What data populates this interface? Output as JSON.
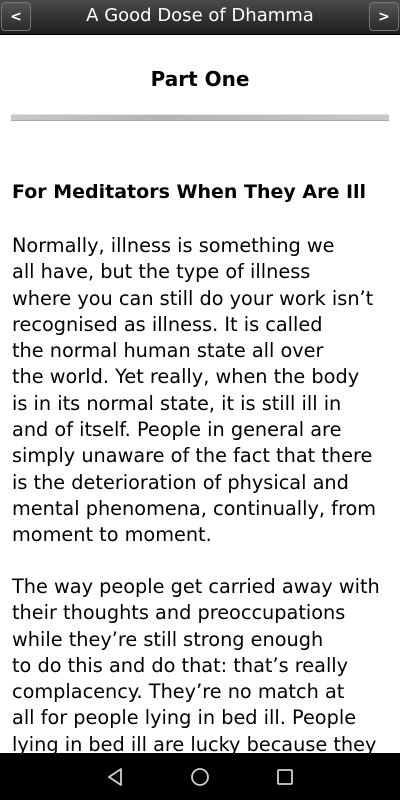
{
  "toolbar": {
    "title": "A Good Dose of Dhamma",
    "prev_label": "<",
    "next_label": ">"
  },
  "content": {
    "part_title": "Part One",
    "section_heading": "For Meditators When They Are Ill",
    "paragraph1_lines": [
      "Normally, illness is something we",
      "all have, but the type of illness",
      "where you can still do your work isn’t",
      "recognised as illness. It is called",
      "the normal human state all over",
      "the world. Yet really, when the body",
      "is in its normal state, it is still ill in",
      "and of itself. People in general are",
      "simply unaware of the fact that there",
      "is the deterioration of physical and",
      "mental phenomena, continually, from",
      "moment to moment."
    ],
    "paragraph2_lines": [
      "The way people get carried away with",
      "their thoughts and preoccupations",
      "while they’re still strong enough",
      "to do this and do that: that’s really",
      "complacency. They’re no match at",
      "all for people lying in bed ill. People",
      "lying in bed ill are lucky because they"
    ]
  },
  "system_nav": {
    "back_icon": "triangle-back-icon",
    "home_icon": "circle-home-icon",
    "recent_icon": "square-recent-icon"
  },
  "colors": {
    "toolbar_bg": "#2b2b2b",
    "text": "#000000",
    "system_bar": "#000000"
  }
}
